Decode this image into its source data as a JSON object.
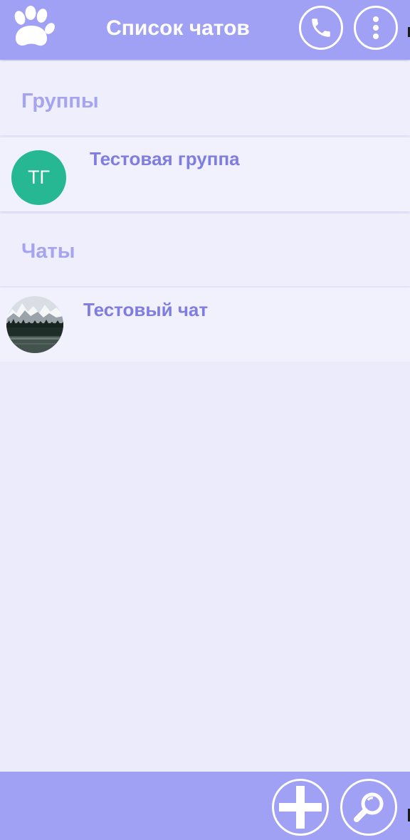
{
  "header": {
    "title": "Список чатов",
    "logo_icon": "paw-icon",
    "call_icon": "phone-icon",
    "menu_icon": "more-vertical-icon"
  },
  "sections": {
    "groups": {
      "title": "Группы",
      "items": [
        {
          "name": "Тестовая группа",
          "avatar_initials": "ТГ",
          "avatar_color": "#26b893"
        }
      ]
    },
    "chats": {
      "title": "Чаты",
      "items": [
        {
          "name": "Тестовый чат",
          "avatar": "mountain-lake-photo"
        }
      ]
    }
  },
  "footer": {
    "add_icon": "plus-icon",
    "search_icon": "search-icon"
  },
  "colors": {
    "accent": "#a0a0f5",
    "background": "#ecebfb",
    "section_label": "#a6a4ee",
    "item_name": "#7f7de0"
  }
}
